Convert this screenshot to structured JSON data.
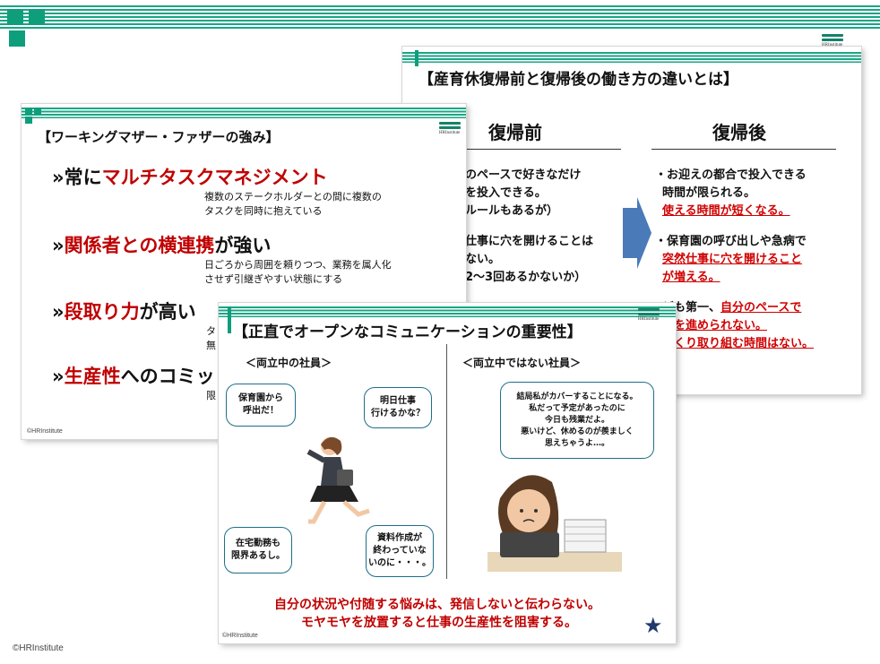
{
  "footer_copyright": "©HRInstitute",
  "slide_right": {
    "title": "【産育休復帰前と復帰後の働き方の違いとは】",
    "col_before": "復帰前",
    "col_after": "復帰後",
    "before_lines": [
      "のペースで好きなだけ",
      "を投入できる。",
      "ルールもあるが）",
      "仕事に穴を開けることは",
      "ない。",
      "2〜3回あるかないか）"
    ],
    "after_1a": "・お迎えの都合で投入できる",
    "after_1b": "時間が限られる。",
    "after_1c": "使える時間が短くなる。",
    "after_2a": "・保育園の呼び出しや急病で",
    "after_2b": "突然仕事に穴を開けること",
    "after_2c": "が増える。",
    "after_3a": "ども第一、",
    "after_3b": "自分のペースで",
    "after_3c": "事を進められない。",
    "after_3d": "っくり取り組む時間はない。",
    "logo_text": "HRInstitute"
  },
  "slide_left": {
    "title": "【ワーキングマザー・ファザーの強み】",
    "item1_pre": "»常に",
    "item1_red": "マルチタスクマネジメント",
    "item1_desc1": "複数のステークホルダーとの間に複数の",
    "item1_desc2": "タスクを同時に抱えている",
    "item2_pre": "»",
    "item2_red": "関係者との横連携",
    "item2_post": "が強い",
    "item2_desc1": "日ごろから周囲を頼りつつ、業務を属人化",
    "item2_desc2": "させず引継ぎやすい状態にする",
    "item3_pre": "»",
    "item3_red": "段取り力",
    "item3_post": "が高い",
    "item3_desc1": "タ",
    "item3_desc2": "無",
    "item4_pre": "»",
    "item4_red": "生産性",
    "item4_post": "へのコミッ",
    "item4_desc1": "限",
    "copyright": "©HRInstitute",
    "logo_text": "HRInstitute"
  },
  "slide_front": {
    "title": "【正直でオープンなコミュニケーションの重要性】",
    "left_header": "＜両立中の社員＞",
    "right_header": "＜両立中ではない社員＞",
    "bubble1": "保育園から\n呼出だ！",
    "bubble2": "明日仕事\n行けるかな？",
    "bubble3": "在宅勤務も\n限界あるし。",
    "bubble4": "資料作成が\n終わっていな\nいのに・・・。",
    "bubble5": "結局私がカバーすることになる。\n私だって予定があったのに\n今日も残業だよ。\n悪いけど、休めるのが羨ましく\n思えちゃうよ…。",
    "conclusion1": "自分の状況や付随する悩みは、発信しないと伝わらない。",
    "conclusion2": "モヤモヤを放置すると仕事の生産性を阻害する。",
    "copyright": "©HRInstitute",
    "star": "★",
    "logo_text": "HRInstitute"
  },
  "colors": {
    "accent": "#1aa585",
    "red": "#c00000",
    "arrow": "#4a7ab8",
    "star": "#1f3a6a"
  }
}
